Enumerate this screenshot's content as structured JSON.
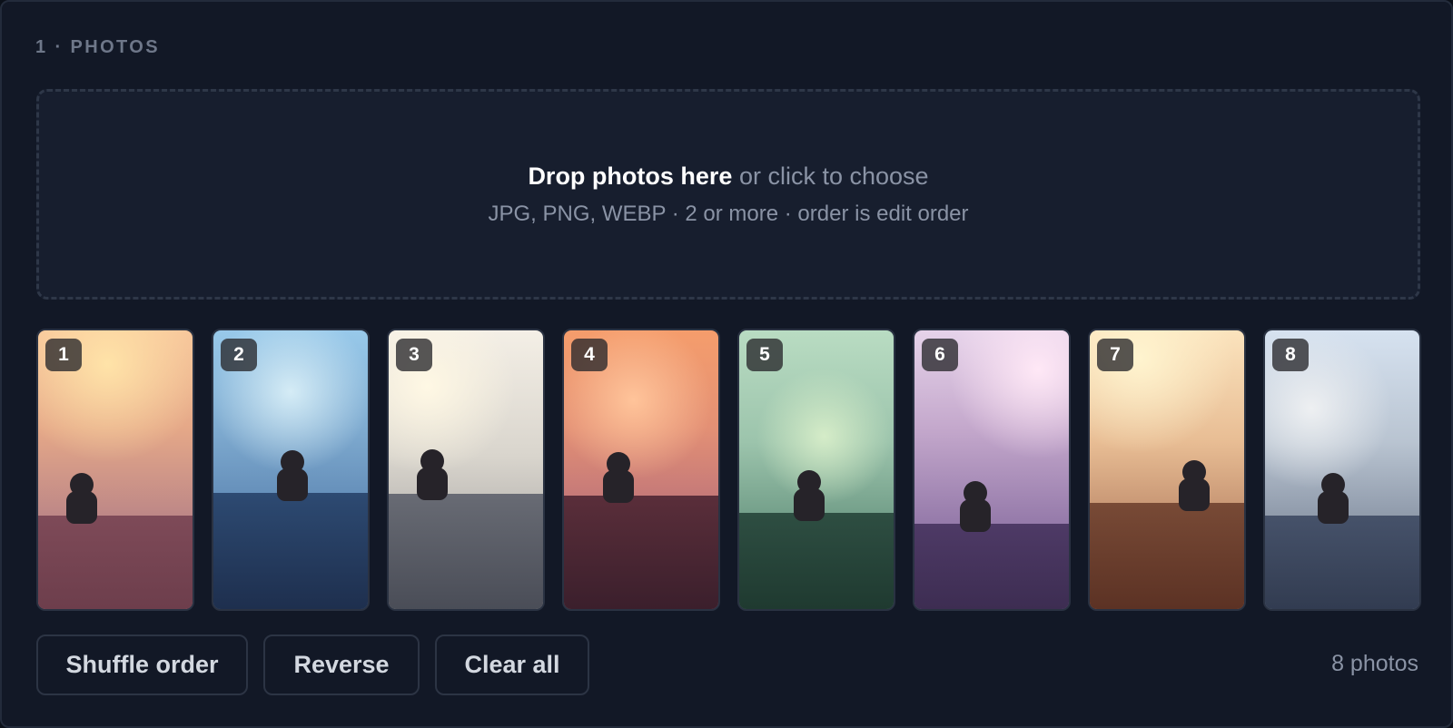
{
  "section": {
    "label": "1 · PHOTOS"
  },
  "dropzone": {
    "title": "Drop photos here",
    "subtitle": " or click to choose",
    "hint": "JPG, PNG, WEBP · 2 or more · order is edit order"
  },
  "photos": [
    {
      "index": "1"
    },
    {
      "index": "2"
    },
    {
      "index": "3"
    },
    {
      "index": "4"
    },
    {
      "index": "5"
    },
    {
      "index": "6"
    },
    {
      "index": "7"
    },
    {
      "index": "8"
    }
  ],
  "actions": {
    "shuffle_label": "Shuffle order",
    "reverse_label": "Reverse",
    "clear_label": "Clear all"
  },
  "status": {
    "count_text": "8 photos"
  },
  "colors": {
    "background": "#121826",
    "dropzone_background": "#171e2e",
    "muted_text": "#8a93a5",
    "button_text": "#d3d8e0"
  }
}
